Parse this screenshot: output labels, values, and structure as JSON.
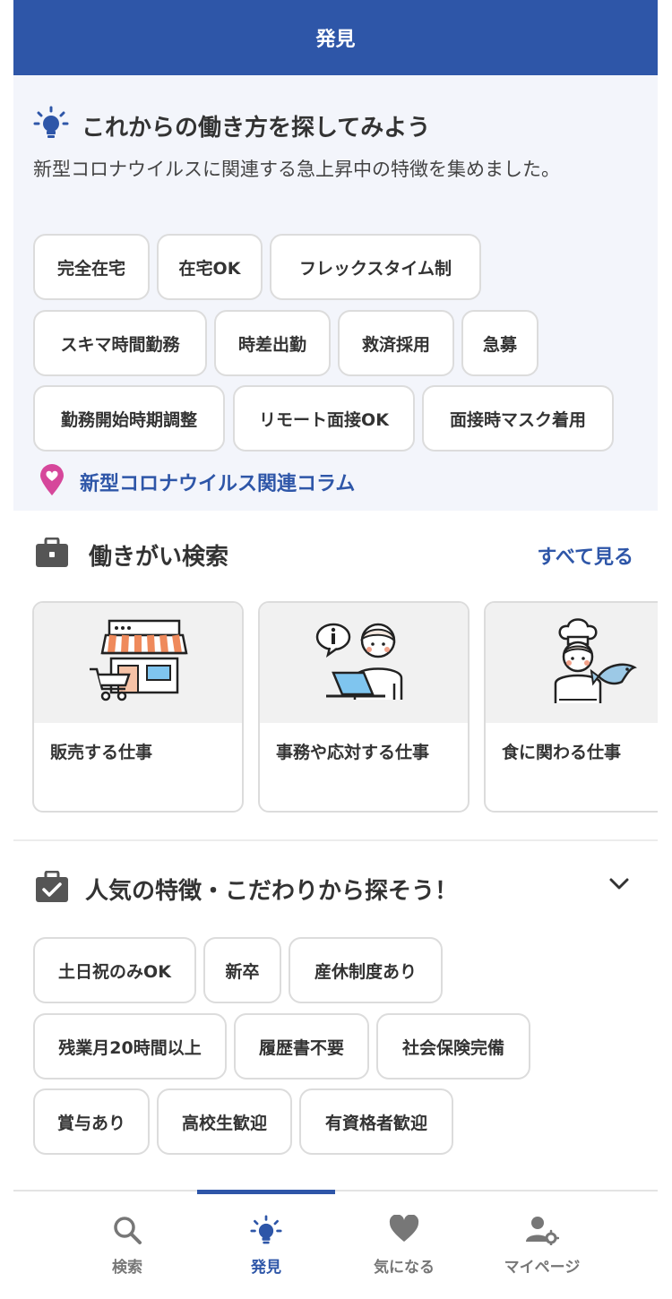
{
  "header": {
    "title": "発見"
  },
  "discover": {
    "title": "これからの働き方を探してみよう",
    "description": "新型コロナウイルスに関連する急上昇中の特徴を集めました。",
    "tags": [
      "完全在宅",
      "在宅OK",
      "フレックスタイム制",
      "スキマ時間勤務",
      "時差出勤",
      "救済採用",
      "急募",
      "勤務開始時期調整",
      "リモート面接OK",
      "面接時マスク着用"
    ],
    "column_link": "新型コロナウイルス関連コラム"
  },
  "search": {
    "title": "働きがい検索",
    "see_all": "すべて見る",
    "cards": [
      "販売する仕事",
      "事務や応対する仕事",
      "食に関わる仕事"
    ]
  },
  "popular": {
    "title": "人気の特徴・こだわりから探そう！",
    "tags": [
      "土日祝のみOK",
      "新卒",
      "産休制度あり",
      "残業月20時間以上",
      "履歴書不要",
      "社会保険完備",
      "賞与あり",
      "高校生歓迎",
      "有資格者歓迎"
    ]
  },
  "nav": {
    "items": [
      {
        "label": "検索",
        "icon": "search-icon"
      },
      {
        "label": "発見",
        "icon": "bulb-icon",
        "active": true
      },
      {
        "label": "気になる",
        "icon": "heart-icon"
      },
      {
        "label": "マイページ",
        "icon": "user-settings-icon"
      }
    ]
  },
  "colors": {
    "brand": "#2e56a8",
    "section_bg": "#f3f5fb",
    "accent_pink": "#d6479b"
  }
}
